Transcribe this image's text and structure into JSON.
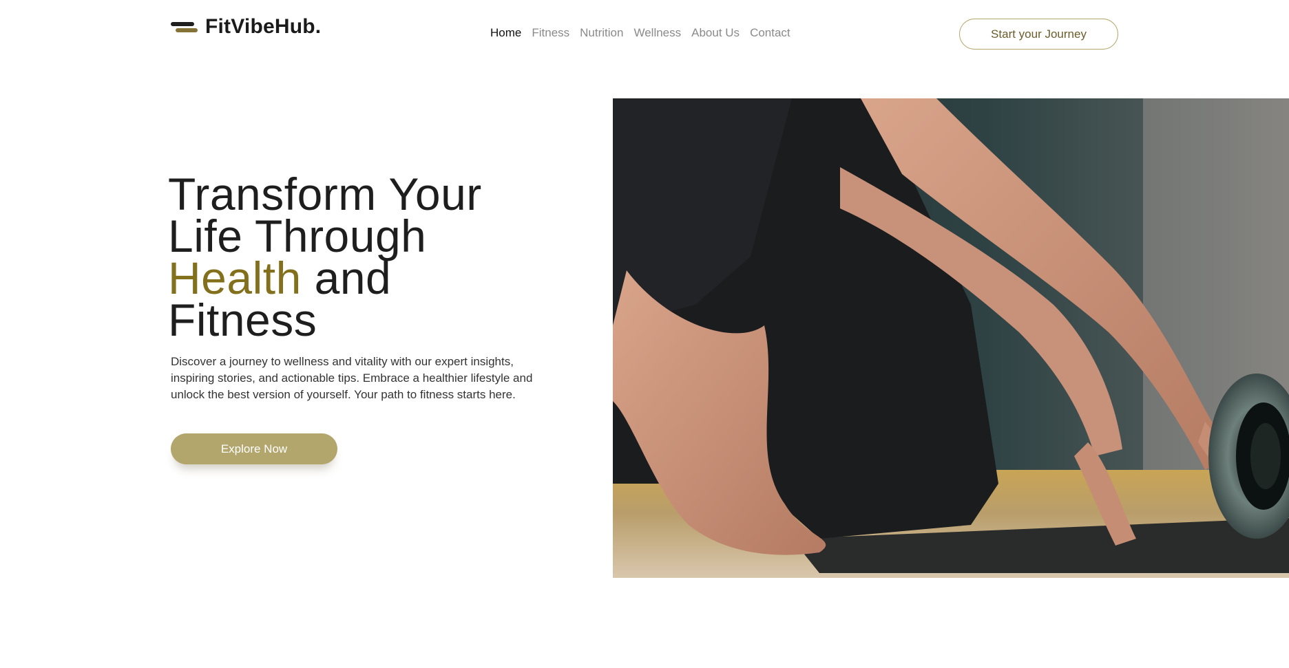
{
  "header": {
    "logo_text": "FitVibeHub.",
    "nav": [
      {
        "label": "Home",
        "active": true
      },
      {
        "label": "Fitness",
        "active": false
      },
      {
        "label": "Nutrition",
        "active": false
      },
      {
        "label": "Wellness",
        "active": false
      },
      {
        "label": "About Us",
        "active": false
      },
      {
        "label": "Contact",
        "active": false
      }
    ],
    "cta_label": "Start your Journey"
  },
  "hero": {
    "title_line1": "Transform Your",
    "title_line2": "Life Through",
    "title_accent": "Health",
    "title_after_accent": " and",
    "title_line4": "Fitness",
    "description": "Discover a journey to wellness and vitality with our expert insights, inspiring stories, and actionable tips. Embrace a healthier lifestyle and unlock the best version of yourself. Your path to fitness starts here.",
    "button_label": "Explore Now",
    "image_icon": "yoga-mat-photo-icon"
  },
  "colors": {
    "accent": "#83701d",
    "button": "#b2a66d",
    "text_dark": "#1e1e1e",
    "nav_muted": "#8a8a8a"
  }
}
